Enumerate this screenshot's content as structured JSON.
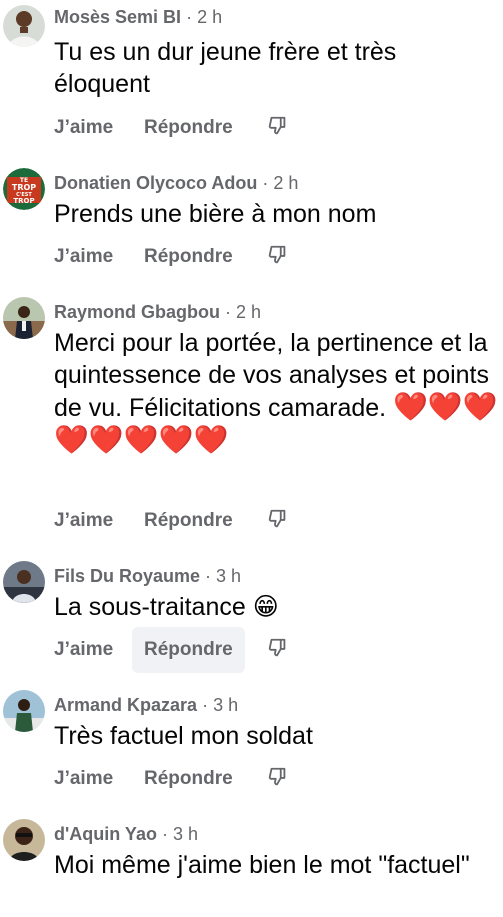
{
  "actions": {
    "like_label": "J’aime",
    "reply_label": "Répondre",
    "react_icon": "thumbs-down-icon"
  },
  "comments": [
    {
      "author": "Mosès Semi BI",
      "time": "2 h",
      "text": "Tu es un dur jeune frère et très éloquent"
    },
    {
      "author": "Donatien Olycoco Adou",
      "time": "2 h",
      "text": "Prends une bière à mon nom",
      "avatar_text": [
        "TE",
        "TROP",
        "C'EST",
        "TROP"
      ]
    },
    {
      "author": "Raymond Gbagbou",
      "time": "2 h",
      "text": "Merci pour la portée, la pertinence et la quintessence de vos analyses et points de vu. Félicitations camarade.",
      "emoji": "❤️❤️❤️❤️❤️❤️❤️❤️"
    },
    {
      "author": "Fils Du Royaume",
      "time": "3 h",
      "text": "La sous-traitance",
      "emoji": "😁"
    },
    {
      "author": "Armand Kpazara",
      "time": "3 h",
      "text": "Très factuel mon soldat"
    },
    {
      "author": "d'Aquin Yao",
      "time": "3 h",
      "text": "Moi même j'aime bien le mot \"factuel\""
    }
  ],
  "colors": {
    "meta_gray": "#65676b",
    "text": "#050505",
    "heart": "#e0222a",
    "hover_bg": "#f0f2f5"
  }
}
